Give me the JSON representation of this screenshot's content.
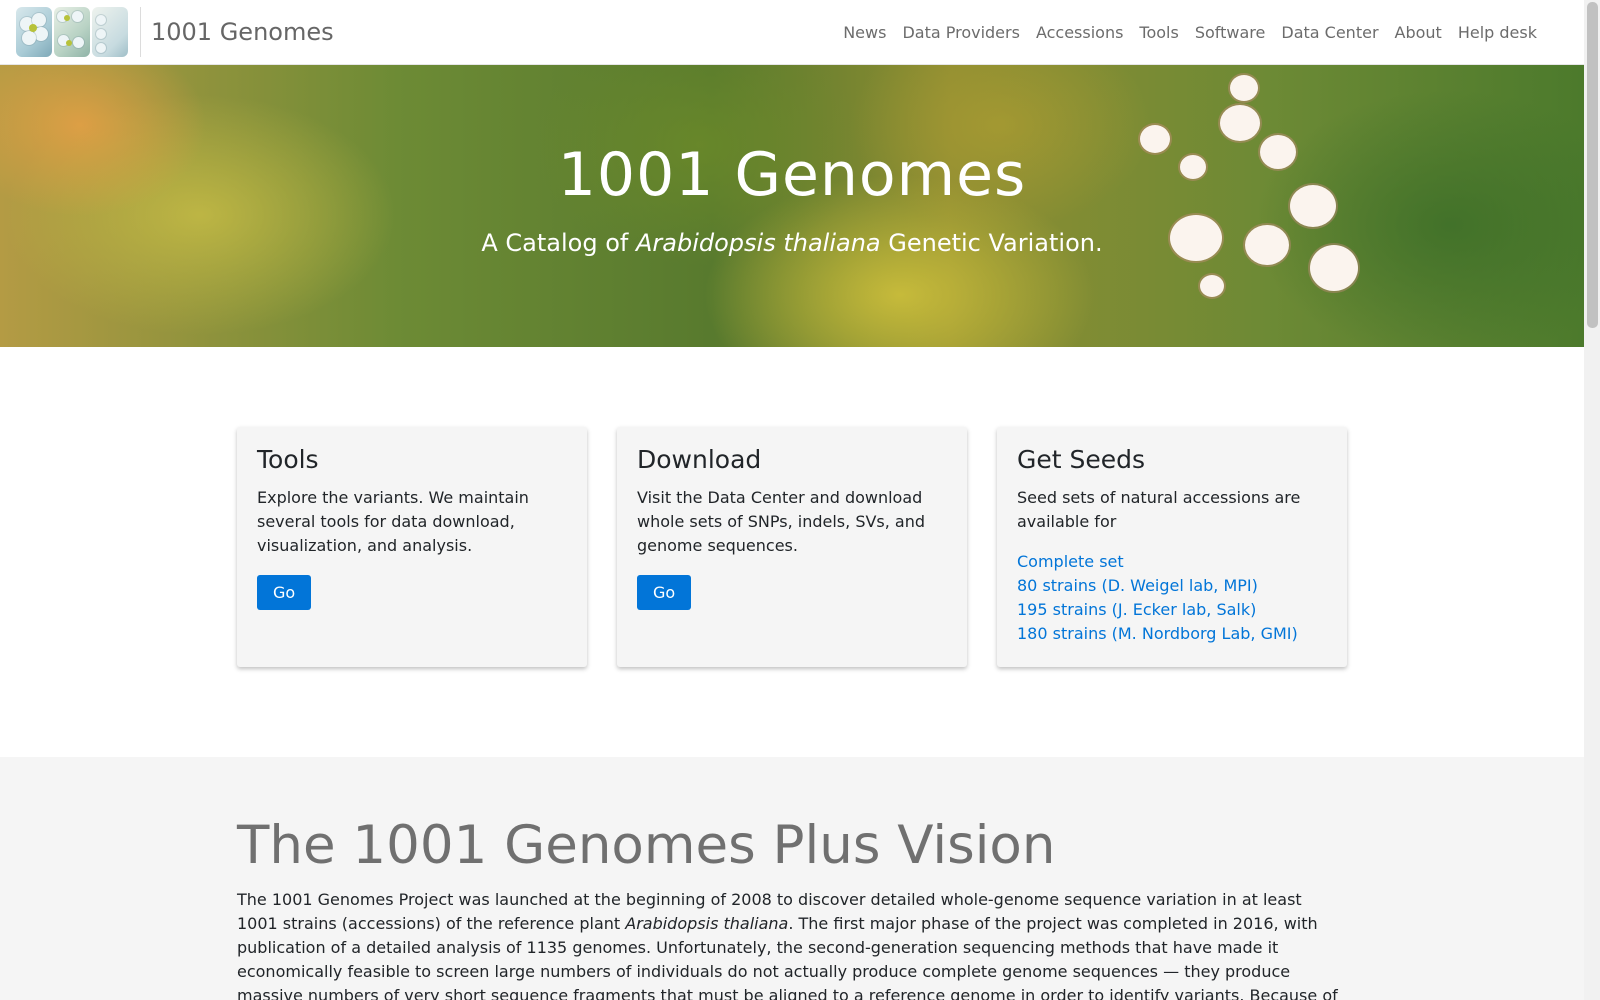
{
  "nav": {
    "brand": "1001 Genomes",
    "links": [
      "News",
      "Data Providers",
      "Accessions",
      "Tools",
      "Software",
      "Data Center",
      "About",
      "Help desk"
    ]
  },
  "hero": {
    "title": "1001 Genomes",
    "subtitle_before": "A Catalog of ",
    "subtitle_em": "Arabidopsis thaliana",
    "subtitle_after": " Genetic Variation."
  },
  "cards": {
    "tools": {
      "title": "Tools",
      "text": "Explore the variants. We maintain several tools for data download, visualization, and analysis.",
      "button": "Go"
    },
    "download": {
      "title": "Download",
      "text": "Visit the Data Center and download whole sets of SNPs, indels, SVs, and genome sequences.",
      "button": "Go"
    },
    "seeds": {
      "title": "Get Seeds",
      "text": "Seed sets of natural accessions are available for",
      "links": [
        "Complete set",
        "80 strains (D. Weigel lab, MPI)",
        "195 strains (J. Ecker lab, Salk)",
        "180 strains (M. Nordborg Lab, GMI)"
      ]
    }
  },
  "vision": {
    "heading": "The 1001 Genomes Plus Vision",
    "p_before": "The 1001 Genomes Project was launched at the beginning of 2008 to discover detailed whole-genome sequence variation in at least 1001 strains (accessions) of the reference plant ",
    "p_em": "Arabidopsis thaliana",
    "p_after": ". The first major phase of the project was completed in 2016, with publication of a detailed analysis of 1135 genomes. Unfortunately, the second-generation sequencing methods that have made it economically feasible to screen large numbers of individuals do not actually produce complete genome sequences — they produce massive numbers of very short sequence fragments that must be aligned to a reference genome in order to identify variants. Because of"
  },
  "colors": {
    "link": "#0275d8",
    "button": "#0275d8",
    "card_bg": "#f5f5f5",
    "section_bg": "#f5f5f5",
    "nav_text": "#6c6c6c"
  }
}
